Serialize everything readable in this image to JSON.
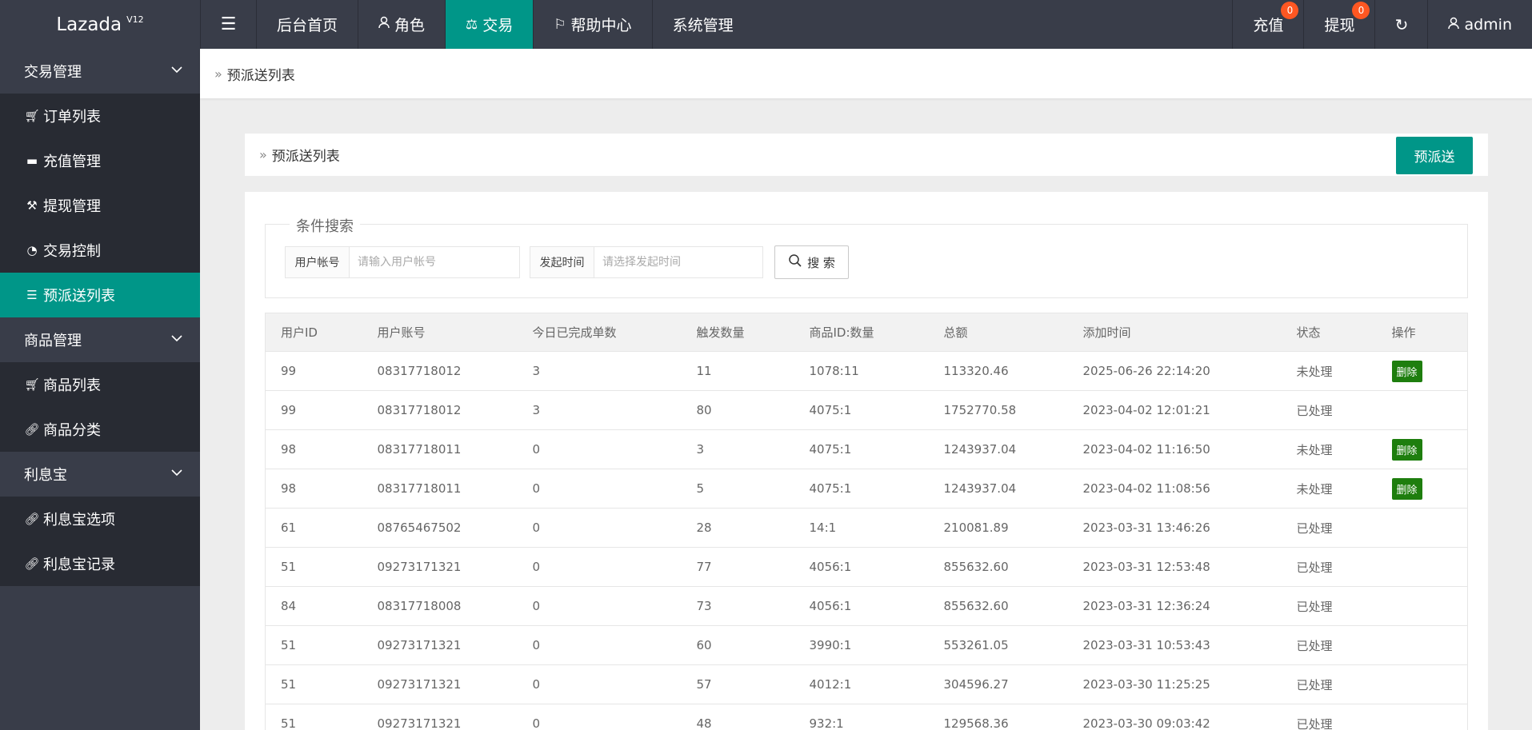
{
  "header": {
    "logo": "Lazada",
    "version": "V12",
    "nav": [
      {
        "label": "后台首页",
        "icon": ""
      },
      {
        "label": "角色",
        "icon": "user-icon"
      },
      {
        "label": "交易",
        "icon": "scale-icon",
        "active": true
      },
      {
        "label": "帮助中心",
        "icon": "flag-icon"
      },
      {
        "label": "系统管理",
        "icon": ""
      }
    ],
    "recharge_label": "充值",
    "recharge_count": "0",
    "withdraw_label": "提现",
    "withdraw_count": "0",
    "user_label": "admin"
  },
  "sidebar": {
    "groups": [
      {
        "label": "交易管理",
        "items": [
          {
            "label": "订单列表",
            "icon": "cart-icon"
          },
          {
            "label": "充值管理",
            "icon": "recharge-icon"
          },
          {
            "label": "提现管理",
            "icon": "gavel-icon"
          },
          {
            "label": "交易控制",
            "icon": "gauge-icon"
          },
          {
            "label": "预派送列表",
            "icon": "list-icon",
            "active": true
          }
        ]
      },
      {
        "label": "商品管理",
        "items": [
          {
            "label": "商品列表",
            "icon": "cart-icon"
          },
          {
            "label": "商品分类",
            "icon": "link-icon"
          }
        ]
      },
      {
        "label": "利息宝",
        "items": [
          {
            "label": "利息宝选项",
            "icon": "link-icon"
          },
          {
            "label": "利息宝记录",
            "icon": "link-icon"
          }
        ]
      }
    ]
  },
  "breadcrumb": "预派送列表",
  "panel": {
    "title": "预派送列表",
    "add_button": "预派送"
  },
  "search": {
    "legend": "条件搜索",
    "account_label": "用户帐号",
    "account_placeholder": "请输入用户帐号",
    "time_label": "发起时间",
    "time_placeholder": "请选择发起时间",
    "search_button": "搜 索"
  },
  "table": {
    "columns": [
      "用户ID",
      "用户账号",
      "今日已完成单数",
      "触发数量",
      "商品ID:数量",
      "总额",
      "添加时间",
      "状态",
      "操作"
    ],
    "delete_label": "删除",
    "rows": [
      {
        "id": "99",
        "account": "08317718012",
        "done": "3",
        "trigger": "11",
        "goods": "1078:11",
        "total": "113320.46",
        "time": "2025-06-26 22:14:20",
        "status": "未处理",
        "deletable": true
      },
      {
        "id": "99",
        "account": "08317718012",
        "done": "3",
        "trigger": "80",
        "goods": "4075:1",
        "total": "1752770.58",
        "time": "2023-04-02 12:01:21",
        "status": "已处理",
        "deletable": false
      },
      {
        "id": "98",
        "account": "08317718011",
        "done": "0",
        "trigger": "3",
        "goods": "4075:1",
        "total": "1243937.04",
        "time": "2023-04-02 11:16:50",
        "status": "未处理",
        "deletable": true
      },
      {
        "id": "98",
        "account": "08317718011",
        "done": "0",
        "trigger": "5",
        "goods": "4075:1",
        "total": "1243937.04",
        "time": "2023-04-02 11:08:56",
        "status": "未处理",
        "deletable": true
      },
      {
        "id": "61",
        "account": "08765467502",
        "done": "0",
        "trigger": "28",
        "goods": "14:1",
        "total": "210081.89",
        "time": "2023-03-31 13:46:26",
        "status": "已处理",
        "deletable": false
      },
      {
        "id": "51",
        "account": "09273171321",
        "done": "0",
        "trigger": "77",
        "goods": "4056:1",
        "total": "855632.60",
        "time": "2023-03-31 12:53:48",
        "status": "已处理",
        "deletable": false
      },
      {
        "id": "84",
        "account": "08317718008",
        "done": "0",
        "trigger": "73",
        "goods": "4056:1",
        "total": "855632.60",
        "time": "2023-03-31 12:36:24",
        "status": "已处理",
        "deletable": false
      },
      {
        "id": "51",
        "account": "09273171321",
        "done": "0",
        "trigger": "60",
        "goods": "3990:1",
        "total": "553261.05",
        "time": "2023-03-31 10:53:43",
        "status": "已处理",
        "deletable": false
      },
      {
        "id": "51",
        "account": "09273171321",
        "done": "0",
        "trigger": "57",
        "goods": "4012:1",
        "total": "304596.27",
        "time": "2023-03-30 11:25:25",
        "status": "已处理",
        "deletable": false
      },
      {
        "id": "51",
        "account": "09273171321",
        "done": "0",
        "trigger": "48",
        "goods": "932:1",
        "total": "129568.36",
        "time": "2023-03-30 09:03:42",
        "status": "已处理",
        "deletable": false
      }
    ]
  },
  "colors": {
    "topbar": "#393d49",
    "accent": "#009688",
    "badge": "#ff5722",
    "delete": "#1e7e0e"
  }
}
